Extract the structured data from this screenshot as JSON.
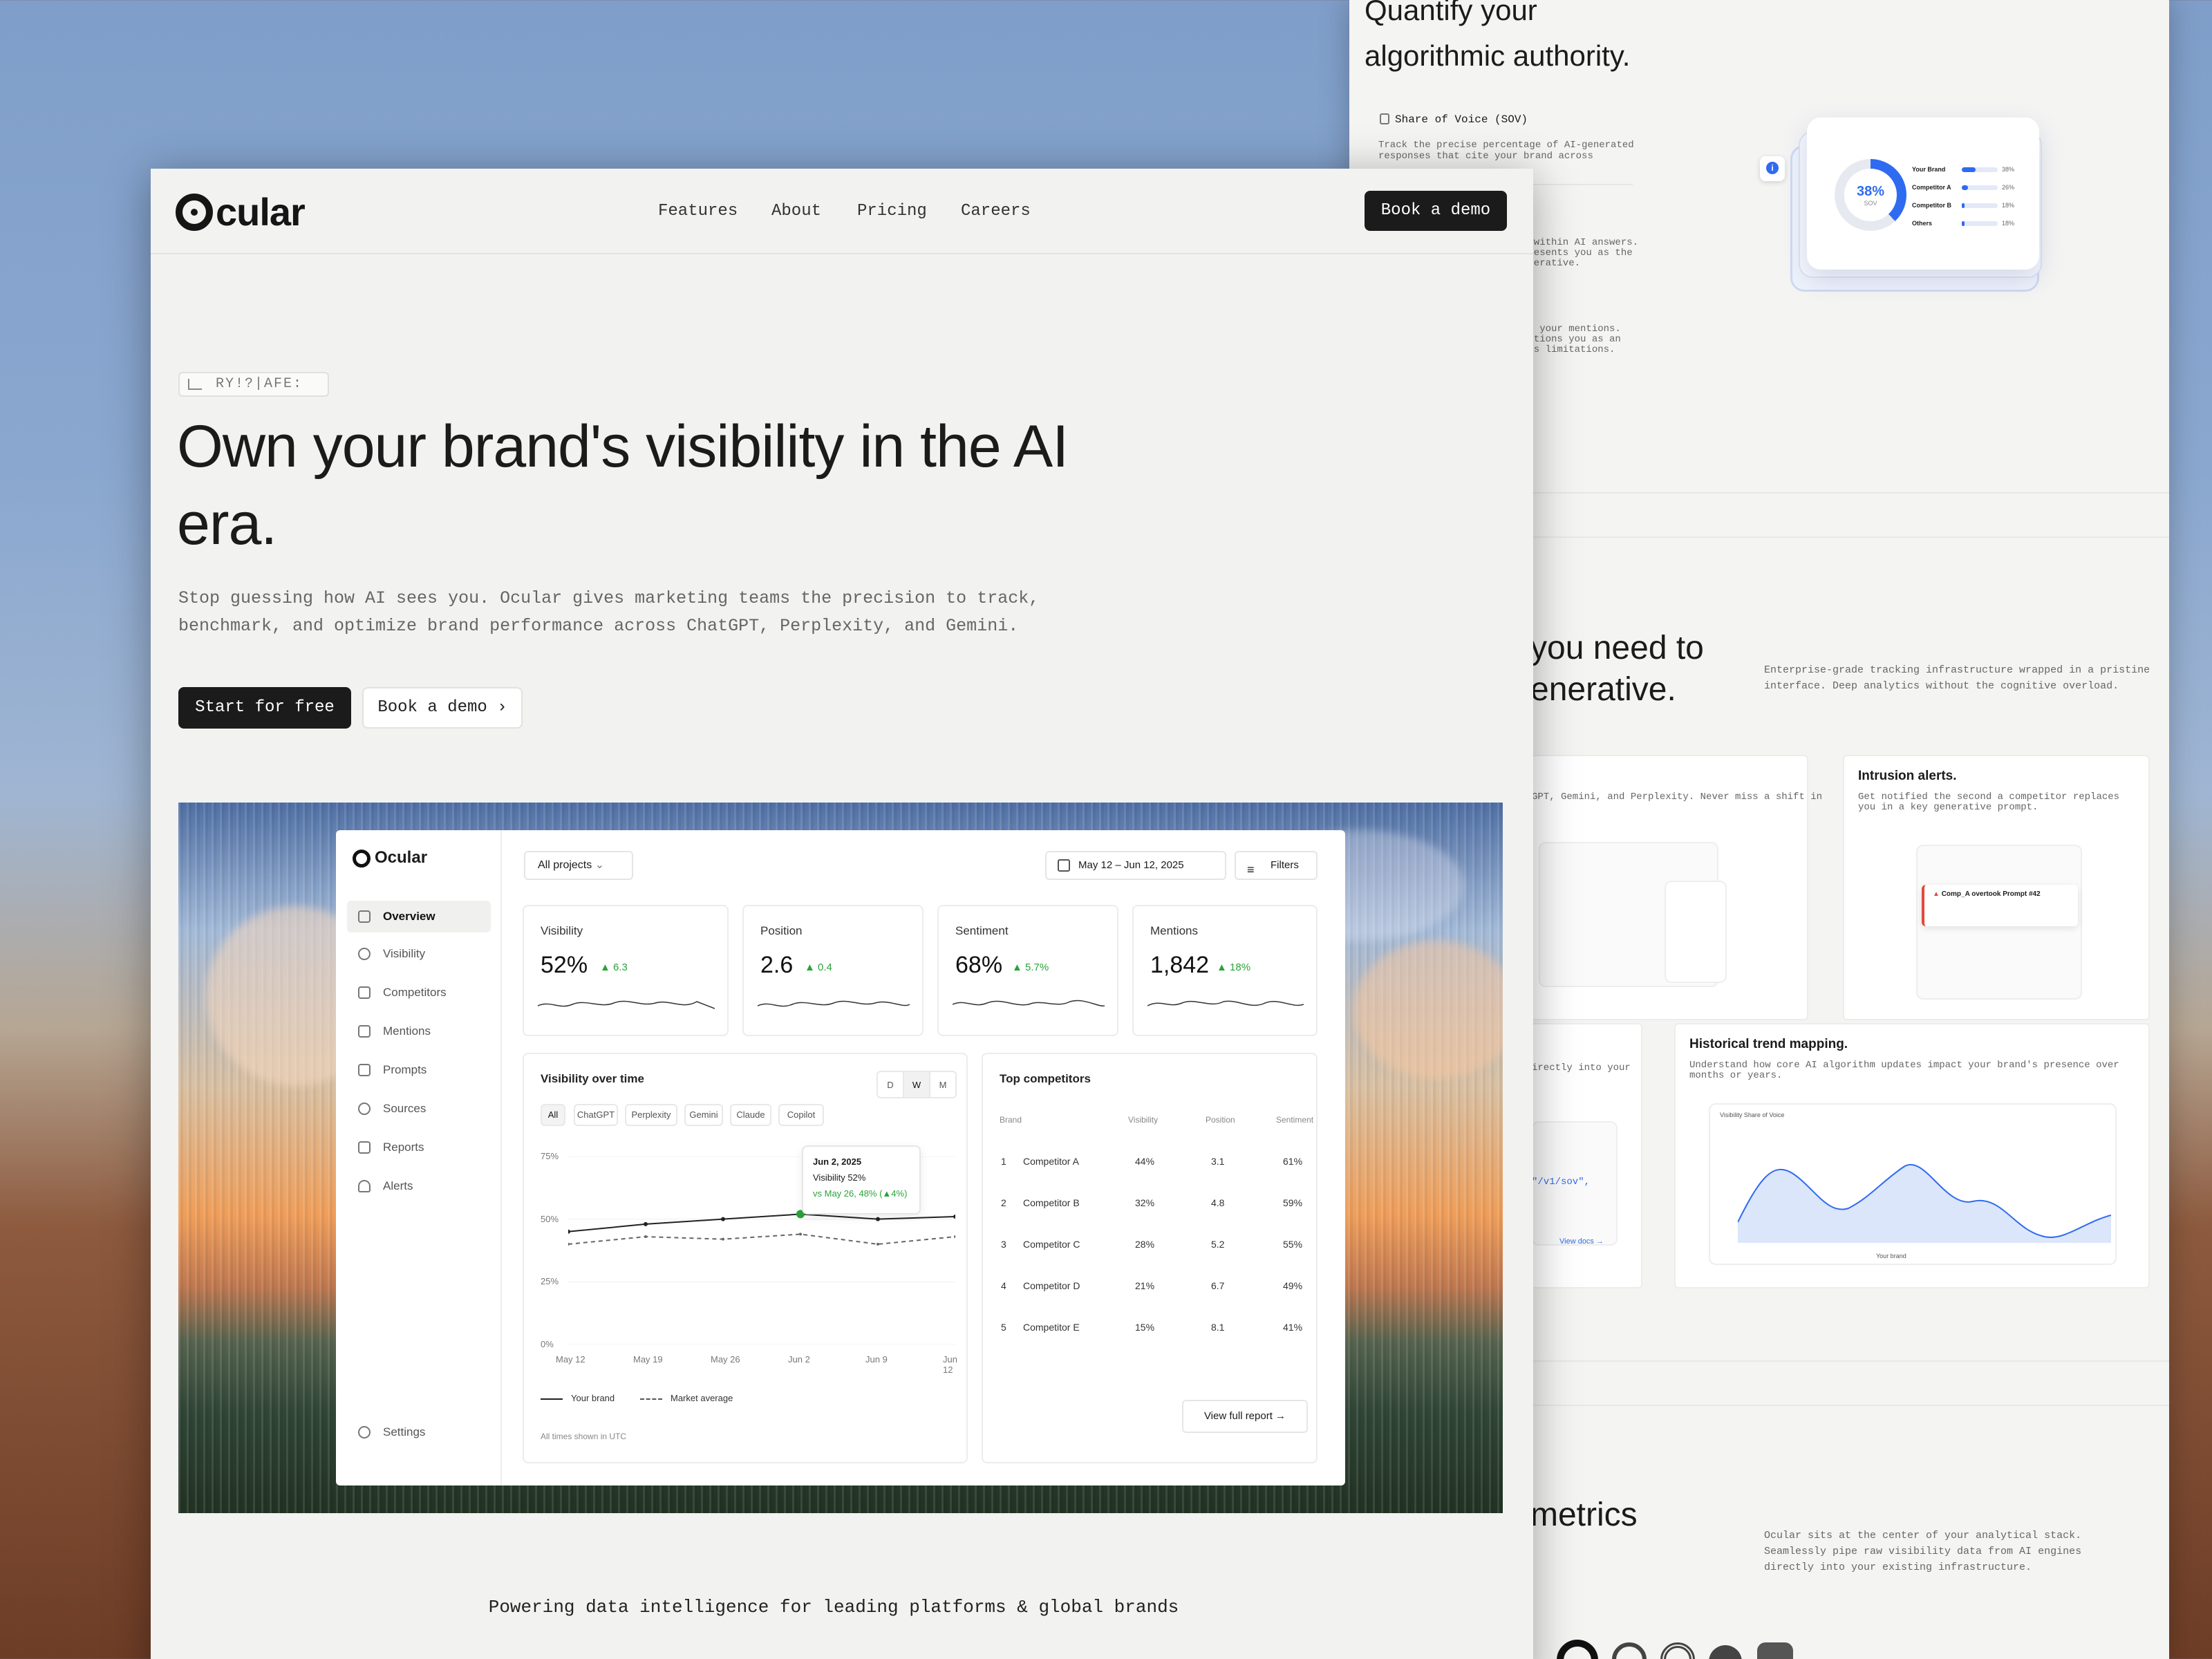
{
  "back_page": {
    "heading": "Quantify your\nalgorithmic authority.",
    "feature_title": "Share of Voice (SOV)",
    "feature_desc": "Track the precise percentage of AI-generated responses that cite your brand across targeted, high-intent user prompts.",
    "frag_1": "t within AI answers.\npresents you as the\nenerative.",
    "frag_2": ":\nof your mentions.\nsitions you as an\nrts limitations.",
    "sov": {
      "percent": "38%",
      "label": "SOV",
      "rows": [
        {
          "name": "Your Brand",
          "pct": "38%",
          "fill": 0.38
        },
        {
          "name": "Competitor A",
          "pct": "26%",
          "fill": 0.26
        },
        {
          "name": "Competitor B",
          "pct": "18%",
          "fill": 0.18
        },
        {
          "name": "Others",
          "pct": "18%",
          "fill": 0.18
        }
      ]
    },
    "section2_heading": "you need to\nenerative.",
    "section2_desc": "Enterprise-grade tracking infrastructure wrapped in a pristine interface. Deep analytics without the cognitive overload.",
    "panel_a_desc": "GPT, Gemini, and Perplexity. Never miss a shift in",
    "panel_b_title": "Intrusion alerts.",
    "panel_b_desc": "Get notified the second a competitor replaces you in a key generative prompt.",
    "panel_b_alert": "Comp_A overtook Prompt #42",
    "panel_c_desc": "irectly into your",
    "panel_c_code": "\"/v1/sov\",",
    "panel_c_link": "View docs →",
    "panel_d_title": "Historical trend mapping.",
    "panel_d_desc": "Understand how core AI algorithm updates impact your brand's presence over months or years.",
    "panel_d_chart_title": "Visibility Share of Voice",
    "panel_d_legend": "Your brand",
    "section3_heading": "metrics",
    "section3_desc": "Ocular sits at the center of your analytical stack. Seamlessly pipe raw visibility data from AI engines directly into your existing infrastructure."
  },
  "nav": {
    "logo": "cular",
    "links": [
      "Features",
      "About",
      "Pricing",
      "Careers"
    ],
    "cta": "Book a demo"
  },
  "hero": {
    "badge": "RY!?|AFE:",
    "title": "Own your brand's visibility in the AI era.",
    "subtitle": "Stop guessing how AI sees you. Ocular gives marketing teams the precision to track, benchmark, and optimize brand performance across ChatGPT, Perplexity, and Gemini.",
    "primary_cta": "Start for free",
    "secondary_cta": "Book a demo",
    "powered_by": "Powering data intelligence for leading platforms & global brands"
  },
  "dashboard": {
    "brand": "Ocular",
    "sidebar": [
      "Overview",
      "Visibility",
      "Competitors",
      "Mentions",
      "Prompts",
      "Sources",
      "Reports",
      "Alerts"
    ],
    "settings": "Settings",
    "project_select": "All projects",
    "date_range": "May 12 – Jun 12, 2025",
    "filters": "Filters",
    "kpis": [
      {
        "label": "Visibility",
        "value": "52%",
        "change": "▲ 6.3"
      },
      {
        "label": "Position",
        "value": "2.6",
        "change": "▲ 0.4"
      },
      {
        "label": "Sentiment",
        "value": "68%",
        "change": "▲ 5.7%"
      },
      {
        "label": "Mentions",
        "value": "1,842",
        "change": "▲ 18%"
      }
    ],
    "chart_title": "Visibility over time",
    "segments": [
      "D",
      "W",
      "M"
    ],
    "engines": [
      "All",
      "ChatGPT",
      "Perplexity",
      "Gemini",
      "Claude",
      "Copilot"
    ],
    "tooltip": {
      "date": "Jun 2, 2025",
      "line1": "Visibility 52%",
      "line2": "vs May 26, 48% (▲4%)"
    },
    "legend": [
      "Your brand",
      "Market average"
    ],
    "footnote": "All times shown in UTC",
    "competitors_title": "Top competitors",
    "competitor_headers": [
      "Brand",
      "Visibility",
      "Position",
      "Sentiment"
    ],
    "competitors": [
      {
        "rank": "1",
        "name": "Competitor A",
        "vis": "44%",
        "pos": "3.1",
        "sent": "61%"
      },
      {
        "rank": "2",
        "name": "Competitor B",
        "vis": "32%",
        "pos": "4.8",
        "sent": "59%"
      },
      {
        "rank": "3",
        "name": "Competitor C",
        "vis": "28%",
        "pos": "5.2",
        "sent": "55%"
      },
      {
        "rank": "4",
        "name": "Competitor D",
        "vis": "21%",
        "pos": "6.7",
        "sent": "49%"
      },
      {
        "rank": "5",
        "name": "Competitor E",
        "vis": "15%",
        "pos": "8.1",
        "sent": "41%"
      }
    ],
    "view_report": "View full report"
  },
  "chart_data": {
    "type": "line",
    "title": "Visibility over time",
    "x": [
      "May 12",
      "May 19",
      "May 26",
      "Jun 2",
      "Jun 9",
      "Jun 12"
    ],
    "yticks": [
      "75%",
      "50%",
      "25%",
      "0%"
    ],
    "ylim": [
      0,
      75
    ],
    "series": [
      {
        "name": "Your brand",
        "values": [
          45,
          48,
          50,
          52,
          50,
          51
        ]
      },
      {
        "name": "Market average",
        "values": [
          40,
          43,
          42,
          44,
          40,
          43
        ]
      }
    ]
  },
  "colors": {
    "accent": "#2f6bf0",
    "positive": "#2aa23a",
    "dark": "#1b1b1b"
  }
}
